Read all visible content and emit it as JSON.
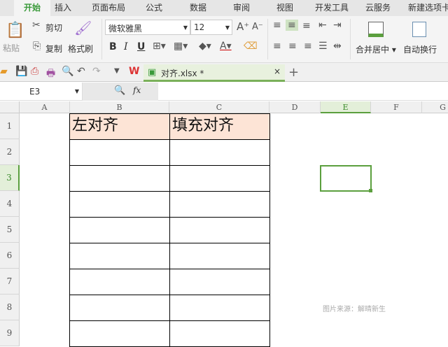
{
  "tabs": [
    "开始",
    "插入",
    "页面布局",
    "公式",
    "数据",
    "审阅",
    "视图",
    "开发工具",
    "云服务",
    "新建选项卡"
  ],
  "ribbon": {
    "paste": "粘贴",
    "cut": "剪切",
    "copy": "复制",
    "format_painter": "格式刷",
    "font_name": "微软雅黑",
    "font_size": "12",
    "bold": "B",
    "italic": "I",
    "underline": "U",
    "merge_center": "合并居中",
    "wrap_text": "自动换行"
  },
  "doc_tab": {
    "name": "对齐.xlsx *"
  },
  "formula_bar": {
    "name_box": "E3",
    "fx": "fx",
    "value": ""
  },
  "columns": [
    "A",
    "B",
    "C",
    "D",
    "E",
    "F",
    "G"
  ],
  "rows": [
    "1",
    "2",
    "3",
    "4",
    "5",
    "6",
    "7",
    "8",
    "9"
  ],
  "cells": {
    "B1": "左对齐",
    "C1": "填充对齐"
  },
  "watermark": "图片来源：解晴新生",
  "colors": {
    "accent": "#5b9f3e",
    "header_fill": "#fde4d6"
  }
}
